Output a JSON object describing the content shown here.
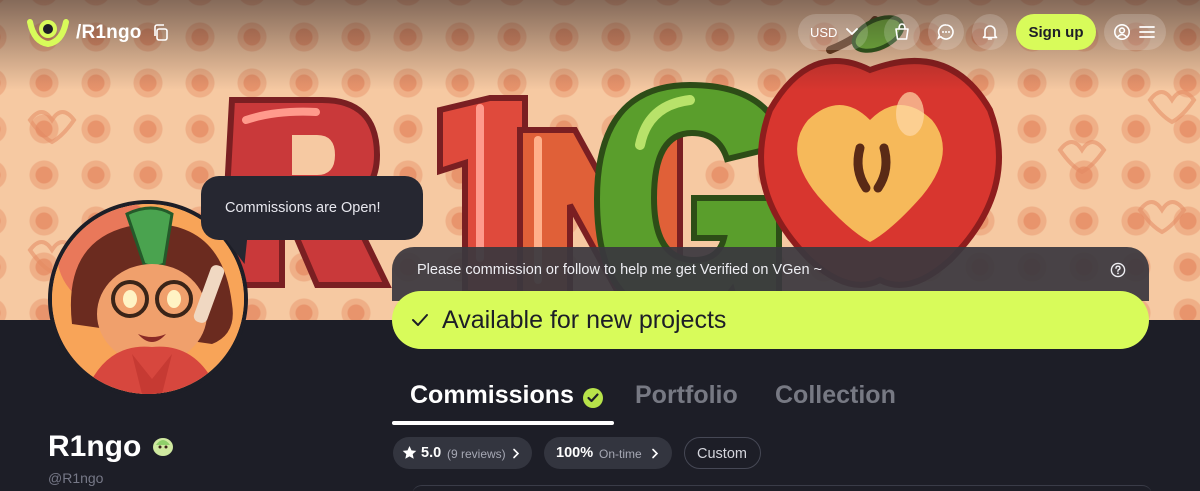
{
  "nav": {
    "handle": "/R1ngo",
    "currency": "USD",
    "signup_label": "Sign up"
  },
  "banner": {
    "title_text": "RINGO"
  },
  "avatar_tooltip": "Commissions are Open!",
  "profile": {
    "name": "R1ngo",
    "handle": "@R1ngo"
  },
  "verify_message": "Please commission or follow to help me get Verified on VGen ~",
  "availability": "Available for new projects",
  "tabs": [
    {
      "label": "Commissions",
      "active": true
    },
    {
      "label": "Portfolio",
      "active": false
    },
    {
      "label": "Collection",
      "active": false
    }
  ],
  "stats": {
    "rating_value": "5.0",
    "rating_reviews": "(9 reviews)",
    "ontime_value": "100%",
    "ontime_label": "On-time",
    "custom_label": "Custom"
  },
  "icons": [
    "vgen-logo-icon",
    "copy-icon",
    "chevron-down-icon",
    "cart-icon",
    "chat-icon",
    "bell-icon",
    "user-icon",
    "menu-icon",
    "help-icon",
    "check-icon",
    "verified-check-icon",
    "star-icon",
    "chevron-right-icon"
  ],
  "colors": {
    "accent": "#d8fb5a",
    "background": "#1d1e27",
    "banner": "#f6c9a2",
    "chip": "#33353f"
  }
}
